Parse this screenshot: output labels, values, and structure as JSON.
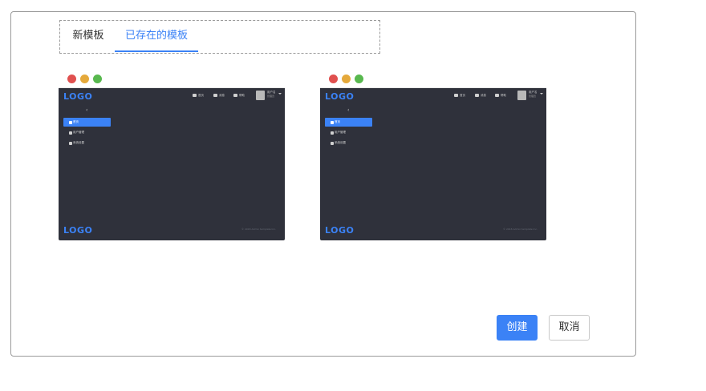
{
  "tabs": [
    {
      "label": "新模板",
      "active": false
    },
    {
      "label": "已存在的模板",
      "active": true
    }
  ],
  "colors": {
    "accent": "#3b82f6",
    "screen_bg": "#2f313b",
    "dot_red": "#e0504f",
    "dot_yellow": "#e5a93b",
    "dot_green": "#58b84e"
  },
  "templates": [
    {
      "logo": "LOGO",
      "nav": [
        "首页",
        "消息",
        "帮助"
      ],
      "user_name": "用户名",
      "user_role": "管理员",
      "collapse_icon": "‹",
      "menu": [
        "首页",
        "用户管理",
        "系统设置"
      ],
      "footer_logo": "LOGO",
      "copyright": "© 2018 Admin template Inc."
    },
    {
      "logo": "LOGO",
      "nav": [
        "首页",
        "消息",
        "帮助"
      ],
      "user_name": "用户名",
      "user_role": "管理员",
      "collapse_icon": "‹",
      "menu": [
        "首页",
        "用户管理",
        "系统设置"
      ],
      "footer_logo": "LOGO",
      "copyright": "© 2018 Admin template Inc."
    }
  ],
  "actions": {
    "create_label": "创建",
    "cancel_label": "取消"
  }
}
